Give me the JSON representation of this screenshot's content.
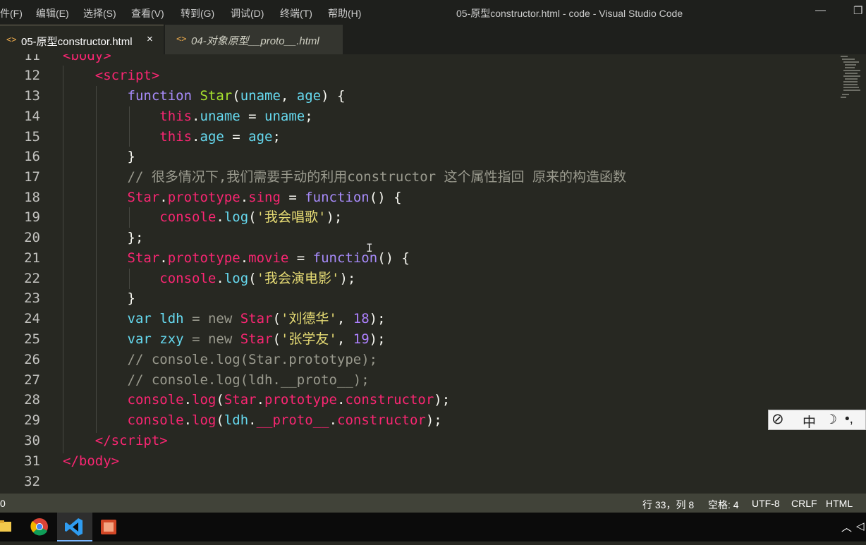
{
  "menu": {
    "items": [
      "件(F)",
      "编辑(E)",
      "选择(S)",
      "查看(V)",
      "转到(G)",
      "调试(D)",
      "终端(T)",
      "帮助(H)"
    ],
    "window_title": "05-原型constructor.html - code - Visual Studio Code"
  },
  "tabs": [
    {
      "label": "05-原型constructor.html",
      "active": true,
      "close": "×"
    },
    {
      "label": "04-对象原型__proto__.html",
      "active": false
    }
  ],
  "editor": {
    "line_numbers": [
      "11",
      "12",
      "13",
      "14",
      "15",
      "16",
      "17",
      "18",
      "19",
      "20",
      "21",
      "22",
      "23",
      "24",
      "25",
      "26",
      "27",
      "28",
      "29",
      "30",
      "31",
      "32"
    ],
    "first_line_partial": "<body>",
    "comment_17": "// 很多情况下,我们需要手动的利用constructor 这个属性指回 原来的构造函数",
    "str_sing": "'我会唱歌'",
    "str_movie": "'我会演电影'",
    "str_ldh": "'刘德华'",
    "str_zxy": "'张学友'",
    "num_18": "18",
    "num_19": "19",
    "comment_26": "// console.log(Star.prototype);",
    "comment_27": "// console.log(ldh.__proto__);"
  },
  "ime": {
    "mode": "中",
    "moon": "☽",
    "punct": "•,"
  },
  "status": {
    "position": "行 33，列 8",
    "spaces": "空格: 4",
    "encoding": "UTF-8",
    "eol": "CRLF",
    "language": "HTML",
    "left": "0"
  },
  "colors": {
    "editor_bg": "#272822",
    "status_bg": "#414339",
    "tab_bar": "#1e1f1c"
  }
}
